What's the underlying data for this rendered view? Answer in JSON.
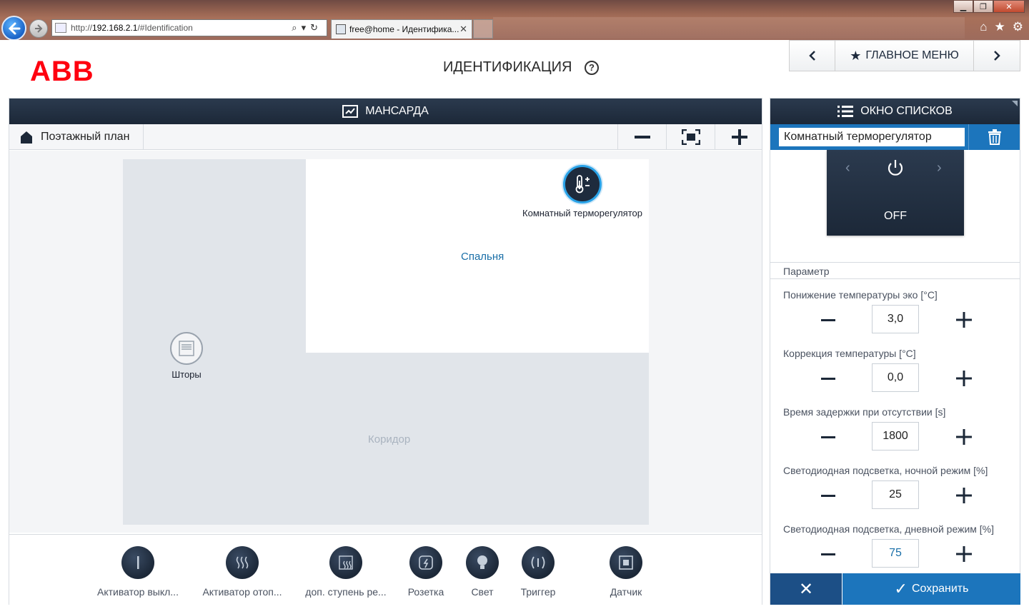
{
  "browser": {
    "url_prefix": "http://",
    "url_host": "192.168.2.1",
    "url_path": "/#Identification",
    "tab_title": "free@home - Идентифика...",
    "tab_close": "✕"
  },
  "header": {
    "logo": "ABB",
    "title": "ИДЕНТИФИКАЦИЯ",
    "help": "?",
    "main_menu": "ГЛАВНОЕ МЕНЮ",
    "prev": "‹",
    "next": "›"
  },
  "plan": {
    "floor_name": "МАНСАРДА",
    "floorplan_tab": "Поэтажный план",
    "zoom_out": "−",
    "zoom_in": "+",
    "rooms": {
      "bedroom": "Спальня",
      "corridor": "Коридор"
    },
    "placed_devices": {
      "thermostat": "Комнатный терморегулятор",
      "blinds": "Шторы"
    }
  },
  "device_bar": [
    {
      "label": "Активатор выкл...",
      "icon": "switch-actuator-icon"
    },
    {
      "label": "Активатор отоп...",
      "icon": "heating-actuator-icon"
    },
    {
      "label": "доп. ступень ре...",
      "icon": "additional-stage-icon"
    },
    {
      "label": "Розетка",
      "icon": "socket-icon"
    },
    {
      "label": "Свет",
      "icon": "light-bulb-icon"
    },
    {
      "label": "Триггер",
      "icon": "trigger-icon"
    },
    {
      "label": "Датчик",
      "icon": "sensor-icon"
    }
  ],
  "list_panel": {
    "title": "ОКНО СПИСКОВ",
    "device_name": "Комнатный терморегулятор",
    "thermostat_state": "OFF",
    "param_header": "Параметр",
    "params": [
      {
        "label": "Понижение температуры эко [°C]",
        "value": "3,0"
      },
      {
        "label": "Коррекция температуры [°C]",
        "value": "0,0"
      },
      {
        "label": "Время задержки при отсутствии [s]",
        "value": "1800"
      },
      {
        "label": "Светодиодная подсветка, ночной режим [%]",
        "value": "25"
      },
      {
        "label": "Светодиодная подсветка, дневной режим [%]",
        "value": "75"
      }
    ],
    "cancel": "✕",
    "save": "Сохранить"
  },
  "colors": {
    "abb_red": "#ff000f",
    "titlebar_dark": "#1c2838",
    "accent_blue": "#1c75bc",
    "room_link": "#1a6fa8"
  }
}
